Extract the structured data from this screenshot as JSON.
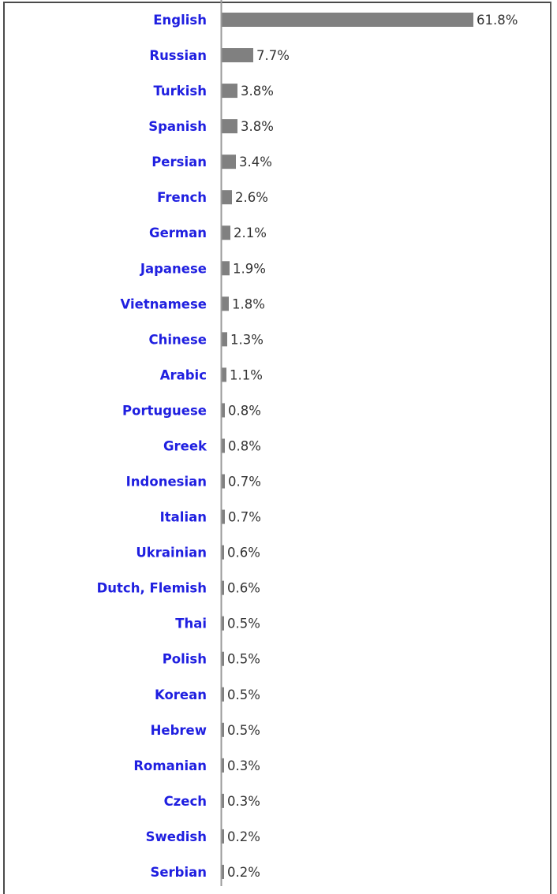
{
  "chart_data": {
    "type": "bar",
    "orientation": "horizontal",
    "title": "",
    "xlabel": "",
    "ylabel": "",
    "value_suffix": "%",
    "xlim": [
      0,
      61.8
    ],
    "grid": false,
    "legend": "none",
    "categories": [
      "English",
      "Russian",
      "Turkish",
      "Spanish",
      "Persian",
      "French",
      "German",
      "Japanese",
      "Vietnamese",
      "Chinese",
      "Arabic",
      "Portuguese",
      "Greek",
      "Indonesian",
      "Italian",
      "Ukrainian",
      "Dutch, Flemish",
      "Thai",
      "Polish",
      "Korean",
      "Hebrew",
      "Romanian",
      "Czech",
      "Swedish",
      "Serbian"
    ],
    "values": [
      61.8,
      7.7,
      3.8,
      3.8,
      3.4,
      2.6,
      2.1,
      1.9,
      1.8,
      1.3,
      1.1,
      0.8,
      0.8,
      0.7,
      0.7,
      0.6,
      0.6,
      0.5,
      0.5,
      0.5,
      0.5,
      0.3,
      0.3,
      0.2,
      0.2
    ],
    "value_labels": [
      "61.8%",
      "7.7%",
      "3.8%",
      "3.8%",
      "3.4%",
      "2.6%",
      "2.1%",
      "1.9%",
      "1.8%",
      "1.3%",
      "1.1%",
      "0.8%",
      "0.8%",
      "0.7%",
      "0.7%",
      "0.6%",
      "0.6%",
      "0.5%",
      "0.5%",
      "0.5%",
      "0.5%",
      "0.3%",
      "0.3%",
      "0.2%",
      "0.2%"
    ]
  },
  "colors": {
    "label": "#1f1fe0",
    "bar": "#808080",
    "axis": "#9a9a9a",
    "value_text": "#333333"
  }
}
